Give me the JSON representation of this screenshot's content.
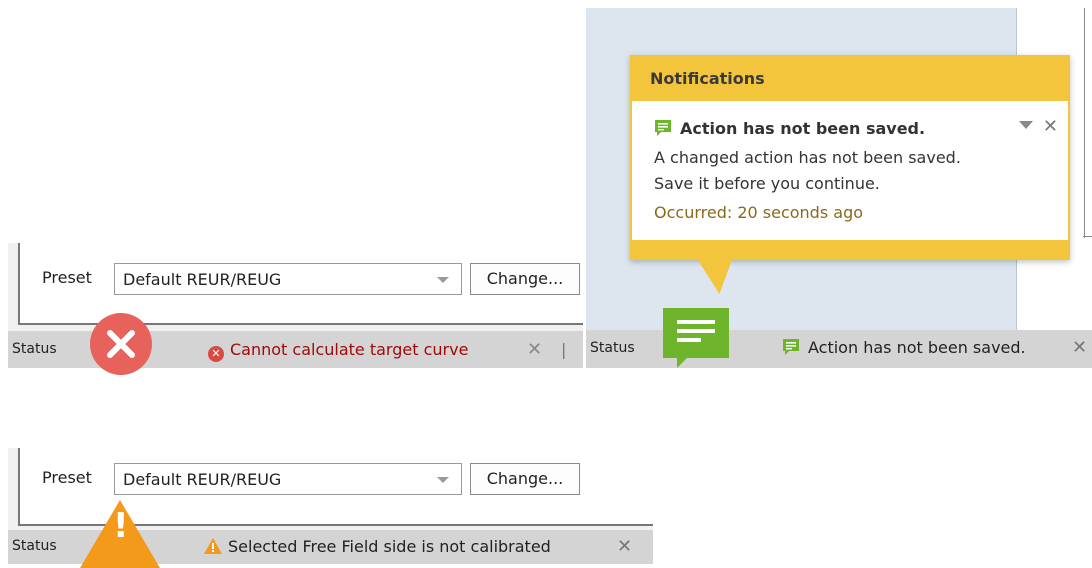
{
  "panels": {
    "error": {
      "preset_label": "Preset",
      "preset_value": "Default REUR/REUG",
      "change_button": "Change...",
      "status_label": "Status",
      "message": "Cannot calculate target curve",
      "close_glyph": "✕",
      "separator": "|",
      "color": "#a00a0a",
      "icon": "error-icon"
    },
    "notification": {
      "header": "Notifications",
      "title": "Action has not been saved.",
      "body_line1": "A changed action has not been saved.",
      "body_line2": "Save it before you continue.",
      "occurred": "Occurred: 20 seconds ago",
      "close_glyph": "✕",
      "status_label": "Status",
      "message": "Action has not been saved.",
      "accent": "#f2c53d",
      "icon": "message-icon"
    },
    "warning": {
      "preset_label": "Preset",
      "preset_value": "Default REUR/REUG",
      "change_button": "Change...",
      "status_label": "Status",
      "message": "Selected Free Field side is not calibrated",
      "close_glyph": "✕",
      "accent": "#f39a1a",
      "icon": "warning-icon"
    }
  }
}
